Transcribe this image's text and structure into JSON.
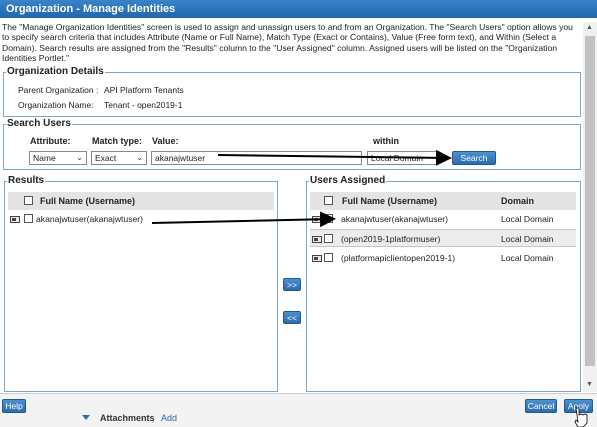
{
  "window": {
    "title": "Organization - Manage Identities"
  },
  "description": "The \"Manage Organization Identities\" screen is used to assign and unassign users to and from an Organization. The \"Search Users\" option allows you to specify search criteria that includes Attribute (Name or Full Name), Match Type (Exact or Contains), Value (Free form text), and Within (Select a Domain). Search results are assigned from the \"Results\" column to the \"User Assigned\" column. Assigned users will be listed on the \"Organization Identities Portlet.\"",
  "org_details": {
    "legend": "Organization Details",
    "parent_label": "Parent Organization :",
    "parent_value": "API Platform Tenants",
    "name_label": "Organization Name:",
    "name_value": "Tenant - open2019-1"
  },
  "search": {
    "legend": "Search Users",
    "attribute_label": "Attribute:",
    "attribute_value": "Name",
    "match_label": "Match type:",
    "match_value": "Exact",
    "value_label": "Value:",
    "value_text": "akanajwtuser",
    "within_label": "within",
    "within_value": "Local Domain",
    "search_button": "Search"
  },
  "results": {
    "legend": "Results",
    "col_fullname": "Full Name (Username)",
    "rows": [
      {
        "name": "akanajwtuser(akanajwtuser)"
      }
    ]
  },
  "transfer": {
    "add": ">>",
    "remove": "<<"
  },
  "assigned": {
    "legend": "Users Assigned",
    "col_fullname": "Full Name (Username)",
    "col_domain": "Domain",
    "rows": [
      {
        "name": "akanajwtuser(akanajwtuser)",
        "domain": "Local Domain"
      },
      {
        "name": "(open2019-1platformuser)",
        "domain": "Local Domain"
      },
      {
        "name": "(platformapiclientopen2019-1)",
        "domain": "Local Domain"
      }
    ]
  },
  "footer": {
    "help": "Help",
    "cancel": "Cancel",
    "apply": "Apply"
  },
  "background": {
    "attachments": "Attachments",
    "add": "Add"
  },
  "colors": {
    "accent": "#2a6cb0",
    "border": "#7fa7c9"
  }
}
